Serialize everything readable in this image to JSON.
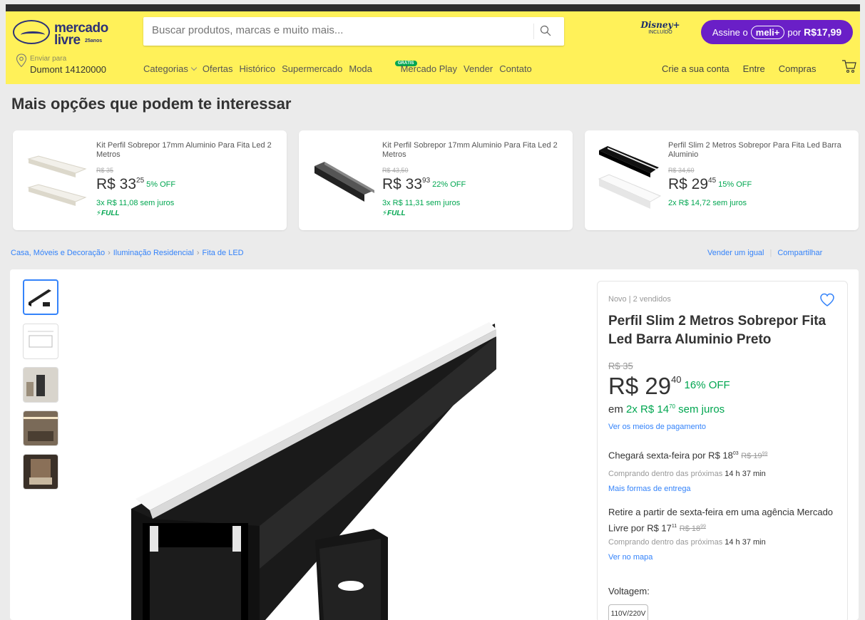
{
  "header": {
    "logo_line1": "mercado",
    "logo_line2": "livre",
    "logo_badge": "25anos",
    "search_placeholder": "Buscar produtos, marcas e muito mais...",
    "disney_logo": "Disney+",
    "disney_sub": "INCLUÍDO",
    "meli_prefix": "Assine o",
    "meli_pill": "meli+",
    "meli_por": "por",
    "meli_price": "R$17,99",
    "location_small": "Enviar para",
    "location_main": "Dumont 14120000",
    "nav": [
      "Categorias",
      "Ofertas",
      "Histórico",
      "Supermercado",
      "Moda",
      "Mercado Play",
      "Vender",
      "Contato"
    ],
    "nav_badge": "GRÁTIS",
    "user_nav": [
      "Crie a sua conta",
      "Entre",
      "Compras"
    ]
  },
  "recommendations": {
    "title": "Mais opções que podem te interessar",
    "items": [
      {
        "title": "Kit Perfil Sobrepor 17mm Aluminio Para Fita Led 2 Metros",
        "old_price": "R$ 35",
        "price_int": "R$ 33",
        "price_cents": "25",
        "off": "5% OFF",
        "installments": "3x R$ 11,08 sem juros",
        "full": "FULL"
      },
      {
        "title": "Kit Perfil Sobrepor 17mm Aluminio Para Fita Led 2 Metros",
        "old_price": "R$ 43,50",
        "price_int": "R$ 33",
        "price_cents": "93",
        "off": "22% OFF",
        "installments": "3x R$ 11,31 sem juros",
        "full": "FULL"
      },
      {
        "title": "Perfil Slim 2 Metros Sobrepor Para Fita Led Barra Aluminio",
        "old_price": "R$ 34,60",
        "price_int": "R$ 29",
        "price_cents": "45",
        "off": "15% OFF",
        "installments": "2x R$ 14,72 sem juros",
        "full": ""
      }
    ]
  },
  "breadcrumb": [
    "Casa, Móveis e Decoração",
    "Iluminação Residencial",
    "Fita de LED"
  ],
  "share": [
    "Vender um igual",
    "Compartilhar"
  ],
  "product": {
    "status": "Novo  |  2 vendidos",
    "title": "Perfil Slim 2 Metros Sobrepor Fita Led Barra Aluminio Preto",
    "old_price": "R$ 35",
    "price_int": "R$ 29",
    "price_cents": "40",
    "off": "16% OFF",
    "inst_prefix": "em",
    "inst_value": "2x R$ 14",
    "inst_cents": "70",
    "inst_suffix": "sem juros",
    "payment_link": "Ver os meios de pagamento",
    "ship_text": "Chegará sexta-feira por R$ 18",
    "ship_cents": "03",
    "ship_old": "R$ 19",
    "ship_old_cents": "99",
    "ship_sub": "Comprando dentro das próximas",
    "ship_time": "14 h 37 min",
    "ship_link": "Mais formas de entrega",
    "pickup_text": "Retire a partir de sexta-feira em uma agência Mercado Livre por R$ 17",
    "pickup_cents": "11",
    "pickup_old": "R$ 18",
    "pickup_old_cents": "99",
    "pickup_sub": "Comprando dentro das próximas",
    "pickup_time": "14 h 37 min",
    "map_link": "Ver no mapa",
    "voltage_label": "Voltagem:",
    "voltage_option": "110V/220V"
  },
  "colors": {
    "header_yellow": "#fff159",
    "accent_blue": "#3483fa",
    "discount_green": "#00a650",
    "meli_purple": "#6a1fc7"
  }
}
